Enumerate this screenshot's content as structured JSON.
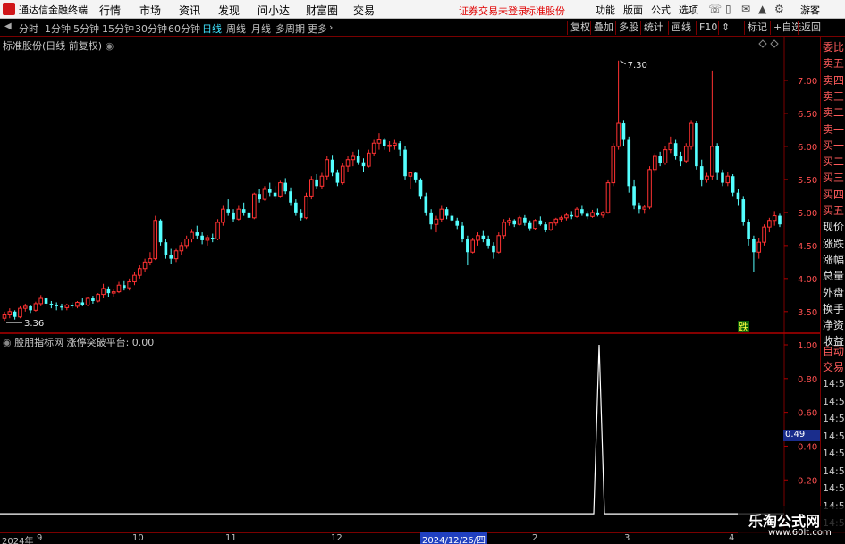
{
  "menubar": {
    "app_title": "通达信金融终端",
    "items": [
      "行情",
      "市场",
      "资讯",
      "发现",
      "问小达",
      "财富圈",
      "交易"
    ],
    "status_text": "证券交易未登录",
    "stock_name": "标准股份",
    "right_buttons": [
      "功能",
      "版面",
      "公式",
      "选项"
    ],
    "guest_label": "游客"
  },
  "toolbar": {
    "periods": [
      "分时",
      "1分钟",
      "5分钟",
      "15分钟",
      "30分钟",
      "60分钟",
      "日线",
      "周线",
      "月线",
      "多周期",
      "更多"
    ],
    "active_period": "日线",
    "right_buttons": [
      "复权",
      "叠加",
      "多股",
      "统计",
      "画线",
      "F10",
      "标记",
      "+自选",
      "返回"
    ]
  },
  "main_chart": {
    "title": "标准股份(日线 前复权)",
    "high_label": "7.30",
    "low_label": "3.36",
    "badge": "跌"
  },
  "indicator": {
    "title": "股朋指标网 涨停突破平台: 0.00",
    "current_value_tag": "0.49"
  },
  "right_panel": {
    "labels": [
      "委比",
      "卖五",
      "卖四",
      "卖三",
      "卖二",
      "卖一",
      "买一",
      "买二",
      "买三",
      "买四",
      "买五",
      "现价",
      "涨跌",
      "涨幅",
      "总量",
      "外盘",
      "换手",
      "净资",
      "收益",
      "自动",
      "交易"
    ],
    "times": [
      "14:56",
      "14:56",
      "14:56",
      "14:56",
      "14:56",
      "14:56",
      "14:56",
      "14:56",
      "14:56"
    ]
  },
  "bottom_axis": {
    "ticks": [
      "2024年",
      "9",
      "10",
      "11",
      "12",
      "2",
      "3",
      "4"
    ],
    "cursor_date": "2024/12/26/四"
  },
  "watermark": {
    "line1": "乐淘公式网",
    "line2": "www.60lt.com"
  },
  "chart_data": [
    {
      "type": "candlestick",
      "title": "标准股份(日线 前复权)",
      "y_ticks": [
        3.5,
        4.0,
        4.5,
        5.0,
        5.5,
        6.0,
        6.5,
        7.0
      ],
      "ylim": [
        3.2,
        7.5
      ],
      "annotations": [
        {
          "text": "7.30",
          "value": 7.3
        },
        {
          "text": "3.36",
          "value": 3.36
        }
      ],
      "up_color": "#ff3232",
      "down_color": "#54ffff",
      "candles": [
        [
          3.4,
          3.5,
          3.36,
          3.45
        ],
        [
          3.45,
          3.55,
          3.4,
          3.5
        ],
        [
          3.5,
          3.52,
          3.38,
          3.42
        ],
        [
          3.42,
          3.58,
          3.4,
          3.55
        ],
        [
          3.55,
          3.62,
          3.5,
          3.58
        ],
        [
          3.58,
          3.6,
          3.48,
          3.52
        ],
        [
          3.52,
          3.65,
          3.5,
          3.62
        ],
        [
          3.62,
          3.75,
          3.58,
          3.7
        ],
        [
          3.7,
          3.72,
          3.58,
          3.62
        ],
        [
          3.62,
          3.66,
          3.55,
          3.6
        ],
        [
          3.6,
          3.64,
          3.52,
          3.58
        ],
        [
          3.58,
          3.62,
          3.52,
          3.56
        ],
        [
          3.56,
          3.62,
          3.52,
          3.6
        ],
        [
          3.6,
          3.64,
          3.55,
          3.58
        ],
        [
          3.58,
          3.66,
          3.55,
          3.64
        ],
        [
          3.64,
          3.7,
          3.58,
          3.6
        ],
        [
          3.6,
          3.72,
          3.58,
          3.7
        ],
        [
          3.7,
          3.74,
          3.62,
          3.66
        ],
        [
          3.66,
          3.78,
          3.64,
          3.76
        ],
        [
          3.76,
          3.92,
          3.7,
          3.85
        ],
        [
          3.85,
          3.88,
          3.72,
          3.78
        ],
        [
          3.78,
          3.84,
          3.72,
          3.8
        ],
        [
          3.8,
          3.95,
          3.78,
          3.9
        ],
        [
          3.9,
          3.96,
          3.82,
          3.86
        ],
        [
          3.86,
          4.0,
          3.82,
          3.95
        ],
        [
          3.95,
          4.1,
          3.9,
          4.05
        ],
        [
          4.05,
          4.2,
          4.0,
          4.15
        ],
        [
          4.15,
          4.3,
          4.1,
          4.25
        ],
        [
          4.25,
          4.4,
          4.2,
          4.3
        ],
        [
          4.3,
          4.95,
          4.28,
          4.88
        ],
        [
          4.88,
          4.9,
          4.5,
          4.55
        ],
        [
          4.55,
          4.6,
          4.3,
          4.35
        ],
        [
          4.35,
          4.45,
          4.22,
          4.3
        ],
        [
          4.3,
          4.45,
          4.25,
          4.42
        ],
        [
          4.42,
          4.55,
          4.35,
          4.5
        ],
        [
          4.5,
          4.65,
          4.45,
          4.6
        ],
        [
          4.6,
          4.75,
          4.55,
          4.7
        ],
        [
          4.7,
          4.8,
          4.6,
          4.65
        ],
        [
          4.65,
          4.7,
          4.52,
          4.58
        ],
        [
          4.58,
          4.66,
          4.5,
          4.62
        ],
        [
          4.62,
          4.68,
          4.55,
          4.6
        ],
        [
          4.6,
          4.9,
          4.58,
          4.85
        ],
        [
          4.85,
          5.1,
          4.8,
          5.05
        ],
        [
          5.05,
          5.2,
          4.95,
          5.0
        ],
        [
          5.0,
          5.05,
          4.85,
          4.9
        ],
        [
          4.9,
          5.1,
          4.88,
          5.05
        ],
        [
          5.05,
          5.15,
          4.95,
          5.0
        ],
        [
          5.0,
          5.05,
          4.88,
          4.92
        ],
        [
          4.92,
          5.3,
          4.9,
          5.28
        ],
        [
          5.28,
          5.35,
          5.15,
          5.2
        ],
        [
          5.2,
          5.4,
          5.18,
          5.35
        ],
        [
          5.35,
          5.45,
          5.25,
          5.3
        ],
        [
          5.3,
          5.4,
          5.2,
          5.25
        ],
        [
          5.25,
          5.48,
          5.22,
          5.45
        ],
        [
          5.45,
          5.52,
          5.28,
          5.32
        ],
        [
          5.32,
          5.38,
          5.1,
          5.15
        ],
        [
          5.15,
          5.2,
          4.95,
          5.0
        ],
        [
          5.0,
          5.05,
          4.88,
          4.92
        ],
        [
          4.92,
          5.3,
          4.9,
          5.25
        ],
        [
          5.25,
          5.55,
          5.2,
          5.5
        ],
        [
          5.5,
          5.58,
          5.35,
          5.4
        ],
        [
          5.4,
          5.6,
          5.35,
          5.55
        ],
        [
          5.55,
          5.85,
          5.5,
          5.8
        ],
        [
          5.8,
          5.86,
          5.55,
          5.6
        ],
        [
          5.6,
          5.65,
          5.4,
          5.45
        ],
        [
          5.45,
          5.75,
          5.42,
          5.7
        ],
        [
          5.7,
          5.85,
          5.62,
          5.8
        ],
        [
          5.8,
          5.92,
          5.7,
          5.85
        ],
        [
          5.85,
          5.95,
          5.72,
          5.76
        ],
        [
          5.76,
          5.82,
          5.62,
          5.7
        ],
        [
          5.7,
          5.95,
          5.68,
          5.9
        ],
        [
          5.9,
          6.1,
          5.85,
          6.05
        ],
        [
          6.05,
          6.2,
          5.95,
          6.1
        ],
        [
          6.1,
          6.12,
          5.95,
          6.0
        ],
        [
          6.0,
          6.08,
          5.92,
          6.02
        ],
        [
          6.02,
          6.1,
          5.95,
          6.05
        ],
        [
          6.05,
          6.08,
          5.85,
          5.95
        ],
        [
          5.95,
          6.0,
          5.5,
          5.55
        ],
        [
          5.55,
          5.62,
          5.35,
          5.6
        ],
        [
          5.6,
          5.62,
          5.45,
          5.5
        ],
        [
          5.5,
          5.52,
          5.2,
          5.25
        ],
        [
          5.25,
          5.3,
          4.95,
          5.0
        ],
        [
          5.0,
          5.05,
          4.75,
          4.82
        ],
        [
          4.82,
          4.95,
          4.7,
          4.9
        ],
        [
          4.9,
          5.1,
          4.85,
          5.05
        ],
        [
          5.05,
          5.08,
          4.9,
          4.95
        ],
        [
          4.95,
          5.0,
          4.85,
          4.88
        ],
        [
          4.88,
          4.92,
          4.75,
          4.8
        ],
        [
          4.8,
          4.85,
          4.55,
          4.6
        ],
        [
          4.6,
          4.65,
          4.2,
          4.4
        ],
        [
          4.4,
          4.62,
          4.38,
          4.58
        ],
        [
          4.58,
          4.7,
          4.5,
          4.65
        ],
        [
          4.65,
          4.72,
          4.55,
          4.6
        ],
        [
          4.6,
          4.65,
          4.45,
          4.5
        ],
        [
          4.5,
          4.55,
          4.3,
          4.4
        ],
        [
          4.4,
          4.7,
          4.38,
          4.65
        ],
        [
          4.65,
          4.9,
          4.6,
          4.85
        ],
        [
          4.85,
          4.92,
          4.8,
          4.88
        ],
        [
          4.88,
          4.9,
          4.78,
          4.82
        ],
        [
          4.82,
          4.95,
          4.8,
          4.92
        ],
        [
          4.92,
          4.96,
          4.8,
          4.84
        ],
        [
          4.84,
          4.88,
          4.72,
          4.76
        ],
        [
          4.76,
          4.9,
          4.74,
          4.88
        ],
        [
          4.88,
          4.94,
          4.8,
          4.82
        ],
        [
          4.82,
          4.85,
          4.7,
          4.74
        ],
        [
          4.74,
          4.86,
          4.72,
          4.84
        ],
        [
          4.84,
          4.92,
          4.8,
          4.9
        ],
        [
          4.9,
          4.95,
          4.85,
          4.92
        ],
        [
          4.92,
          5.0,
          4.88,
          4.96
        ],
        [
          4.96,
          5.02,
          4.9,
          4.94
        ],
        [
          4.94,
          5.08,
          4.92,
          5.05
        ],
        [
          5.05,
          5.1,
          4.95,
          4.98
        ],
        [
          4.98,
          5.02,
          4.9,
          4.94
        ],
        [
          4.94,
          5.04,
          4.92,
          5.0
        ],
        [
          5.0,
          5.06,
          4.94,
          4.96
        ],
        [
          4.96,
          5.02,
          4.92,
          5.0
        ],
        [
          5.0,
          5.5,
          4.98,
          5.45
        ],
        [
          5.45,
          6.05,
          5.4,
          6.0
        ],
        [
          6.0,
          7.3,
          5.95,
          6.35
        ],
        [
          6.35,
          6.4,
          6.0,
          6.1
        ],
        [
          6.1,
          6.15,
          5.3,
          5.4
        ],
        [
          5.4,
          5.5,
          5.05,
          5.1
        ],
        [
          5.1,
          5.15,
          4.98,
          5.05
        ],
        [
          5.05,
          5.12,
          4.98,
          5.08
        ],
        [
          5.08,
          5.7,
          5.05,
          5.65
        ],
        [
          5.65,
          5.9,
          5.6,
          5.85
        ],
        [
          5.85,
          5.92,
          5.7,
          5.75
        ],
        [
          5.75,
          6.0,
          5.72,
          5.95
        ],
        [
          5.95,
          6.15,
          5.9,
          6.05
        ],
        [
          6.05,
          6.1,
          5.8,
          5.85
        ],
        [
          5.85,
          5.92,
          5.7,
          5.78
        ],
        [
          5.78,
          6.05,
          5.75,
          6.0
        ],
        [
          6.0,
          6.4,
          5.95,
          6.35
        ],
        [
          6.35,
          6.38,
          5.65,
          5.7
        ],
        [
          5.7,
          5.8,
          5.4,
          5.5
        ],
        [
          5.5,
          5.6,
          5.45,
          5.55
        ],
        [
          5.55,
          7.15,
          5.5,
          6.0
        ],
        [
          6.0,
          6.05,
          5.5,
          5.6
        ],
        [
          5.6,
          5.65,
          5.4,
          5.45
        ],
        [
          5.45,
          5.62,
          5.4,
          5.55
        ],
        [
          5.55,
          5.58,
          5.25,
          5.3
        ],
        [
          5.3,
          5.35,
          5.1,
          5.2
        ],
        [
          5.2,
          5.25,
          4.8,
          4.85
        ],
        [
          4.85,
          4.9,
          4.5,
          4.6
        ],
        [
          4.6,
          4.65,
          4.1,
          4.4
        ],
        [
          4.4,
          4.62,
          4.3,
          4.55
        ],
        [
          4.55,
          4.82,
          4.5,
          4.78
        ],
        [
          4.78,
          4.92,
          4.7,
          4.88
        ],
        [
          4.88,
          5.02,
          4.8,
          4.95
        ],
        [
          4.95,
          4.98,
          4.78,
          4.82
        ]
      ]
    },
    {
      "type": "line",
      "title": "涨停突破平台",
      "y_ticks": [
        0.2,
        0.4,
        0.6,
        0.8,
        1.0
      ],
      "ylim": [
        -0.1,
        1.0
      ],
      "line_color": "#ffffff",
      "spike_at": "2024/12/26/四",
      "value": 1.0
    }
  ]
}
